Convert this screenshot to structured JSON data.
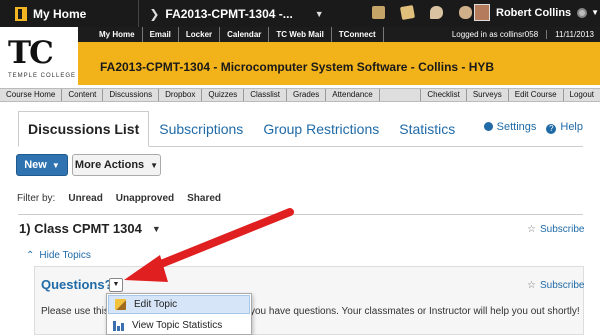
{
  "minibar": {
    "my_home": "My Home",
    "course": "FA2013-CPMT-1304 -...",
    "user": "Robert Collins"
  },
  "banner": {
    "logo_text": "TC",
    "logo_sub": "TEMPLE COLLEGE",
    "nav_links": [
      "My Home",
      "Email",
      "Locker",
      "Calendar",
      "TC Web Mail",
      "TConnect"
    ],
    "logged_in": "Logged in as collinsr058",
    "date": "11/11/2013",
    "course_title": "FA2013-CPMT-1304 - Microcomputer System Software - Collins - HYB"
  },
  "coursebar": {
    "left_items": [
      "Course Home",
      "Content",
      "Discussions",
      "Dropbox",
      "Quizzes",
      "Classlist",
      "Grades",
      "Attendance"
    ],
    "right_items": [
      "Checklist",
      "Surveys",
      "Edit Course",
      "Logout"
    ]
  },
  "tabs": {
    "items": [
      "Discussions List",
      "Subscriptions",
      "Group Restrictions",
      "Statistics"
    ],
    "settings": "Settings",
    "help": "Help"
  },
  "buttons": {
    "new": "New",
    "more_actions": "More Actions"
  },
  "filter": {
    "label": "Filter by:",
    "options": [
      "Unread",
      "Unapproved",
      "Shared"
    ]
  },
  "category": {
    "title": "1) Class CPMT 1304",
    "subscribe": "Subscribe",
    "hide_topics": "Hide Topics"
  },
  "topic": {
    "title": "Questions?",
    "subscribe": "Subscribe",
    "desc_left": "Please use this f",
    "desc_right": "you have questions. Your classmates or Instructor will help you out shortly!"
  },
  "dropdown": {
    "items": [
      "Edit Topic",
      "View Topic Statistics"
    ]
  },
  "colors": {
    "brand_yellow": "#f2b21a",
    "link_blue": "#1f6aa7",
    "button_blue": "#2f73b0",
    "annotation_red": "#e02020"
  }
}
